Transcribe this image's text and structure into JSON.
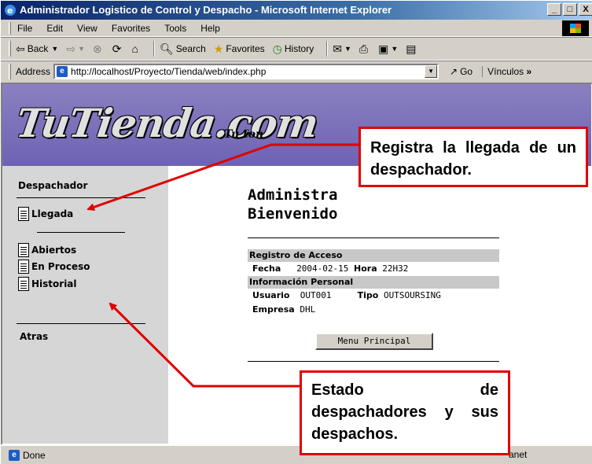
{
  "window": {
    "title": "Administrador Logistico de Control y Despacho - Microsoft Internet Explorer",
    "controls": [
      "_",
      "□",
      "X"
    ]
  },
  "menubar": {
    "items": [
      "File",
      "Edit",
      "View",
      "Favorites",
      "Tools",
      "Help"
    ]
  },
  "toolbar": {
    "back": "Back",
    "search": "Search",
    "favorites": "Favorites",
    "history": "History"
  },
  "addressbar": {
    "label": "Address",
    "url": "http://localhost/Proyecto/Tienda/web/index.php",
    "go": "Go",
    "links": "Vínculos"
  },
  "banner": {
    "logo": "TuTienda.com",
    "tagline": "Tu ton"
  },
  "sidebar": {
    "section_title": "Despachador",
    "links": [
      "Llegada",
      "Abiertos",
      "En Proceso",
      "Historial"
    ],
    "back": "Atras"
  },
  "main": {
    "title_line1": "Administra",
    "title_line2": "Bienvenido",
    "access_section": "Registro de Acceso",
    "fecha_label": "Fecha",
    "fecha_value": "2004-02-15",
    "hora_label": "Hora",
    "hora_value": "22H32",
    "personal_section": "Información Personal",
    "usuario_label": "Usuario",
    "usuario_value": "OUT001",
    "tipo_label": "Tipo",
    "tipo_value": "OUTSOURSING",
    "empresa_label": "Empresa",
    "empresa_value": "DHL",
    "menu_button": "Menu Principal"
  },
  "statusbar": {
    "status": "Done",
    "zone": "anet"
  },
  "callouts": {
    "top": "Registra la llegada de un despachador.",
    "bottom": "Estado de despachadores y sus despachos."
  },
  "colors": {
    "callout_border": "#e00000",
    "banner": "#7a70ba",
    "sidebar": "#d6d6d6"
  }
}
